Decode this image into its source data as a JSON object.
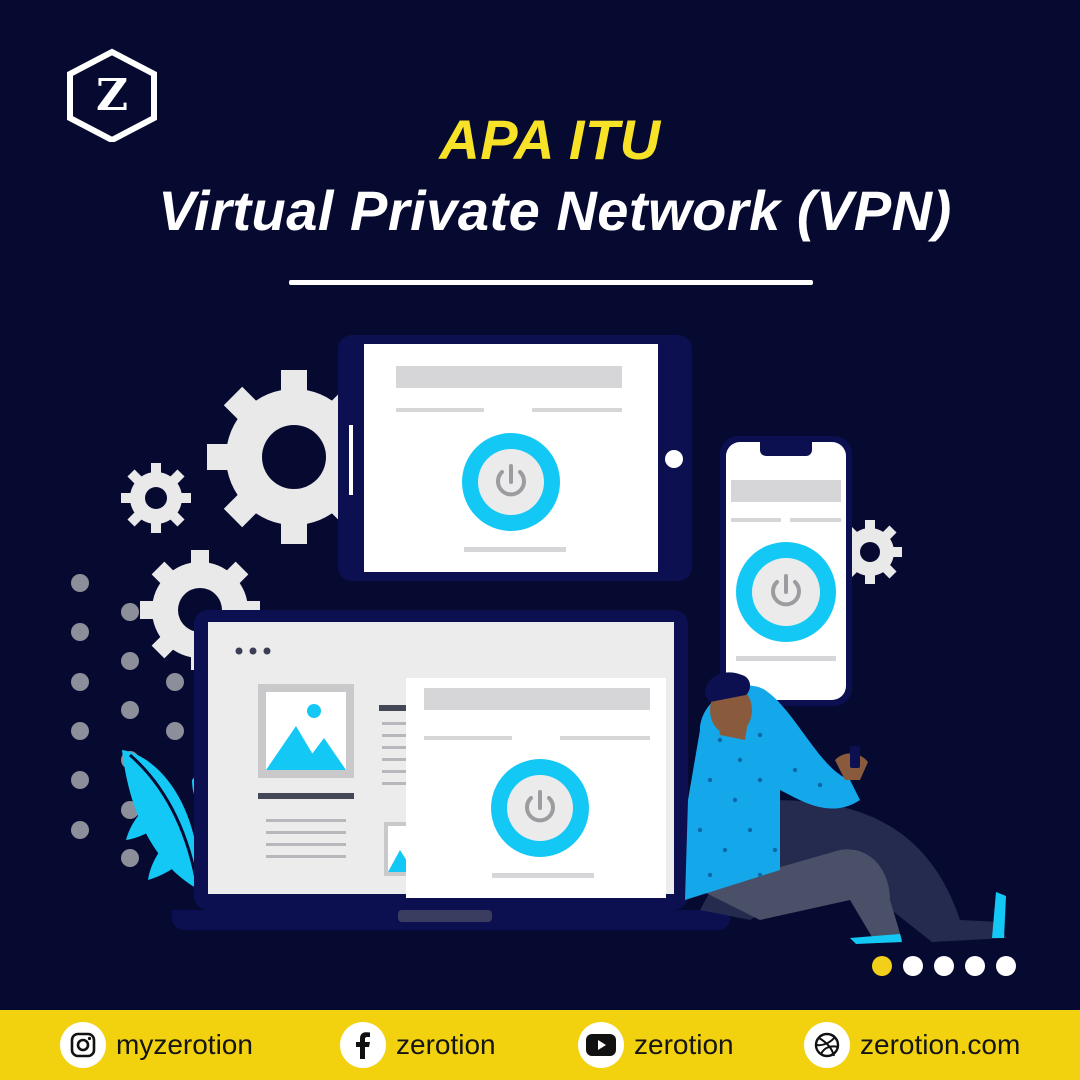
{
  "brand": {
    "logo_letter": "Z"
  },
  "title": {
    "line1": "APA ITU",
    "line2": "Virtual Private Network (VPN)"
  },
  "colors": {
    "background": "#070a30",
    "accent_yellow": "#f7e228",
    "footer": "#f2d10f",
    "vpn_cyan": "#14c8f5"
  },
  "pager": {
    "total": 5,
    "active_index": 0
  },
  "social": [
    {
      "icon": "instagram-icon",
      "label": "myzerotion"
    },
    {
      "icon": "facebook-icon",
      "label": "zerotion"
    },
    {
      "icon": "youtube-icon",
      "label": "zerotion"
    },
    {
      "icon": "dribbble-icon",
      "label": "zerotion.com"
    }
  ]
}
